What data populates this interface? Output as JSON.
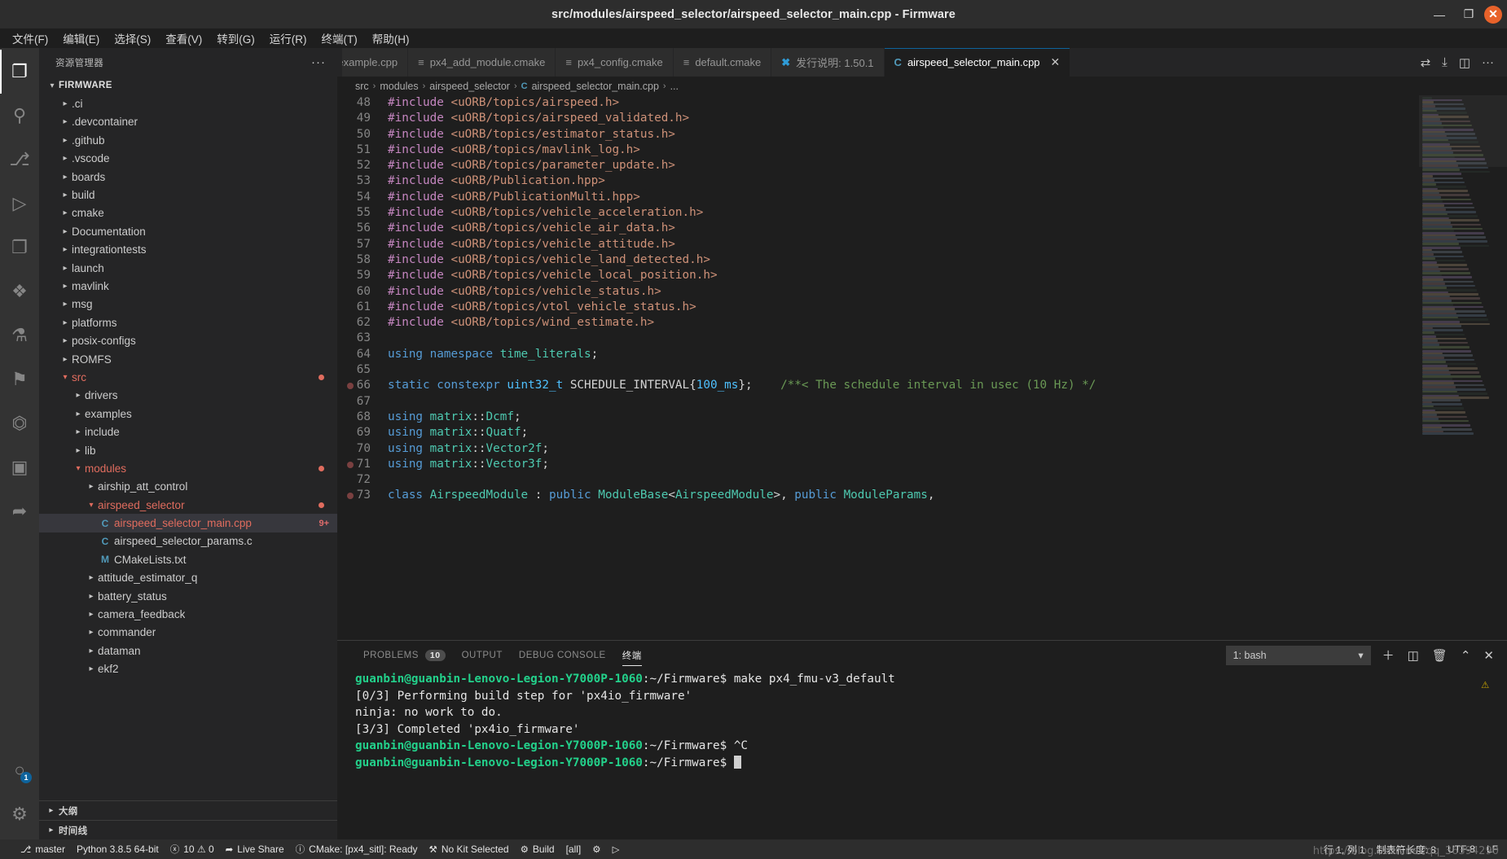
{
  "window": {
    "title": "src/modules/airspeed_selector/airspeed_selector_main.cpp - Firmware",
    "minimize": "—",
    "maximize": "❐",
    "close": "✕"
  },
  "menubar": [
    {
      "label": "文件(F)"
    },
    {
      "label": "编辑(E)"
    },
    {
      "label": "选择(S)"
    },
    {
      "label": "查看(V)"
    },
    {
      "label": "转到(G)"
    },
    {
      "label": "运行(R)"
    },
    {
      "label": "终端(T)"
    },
    {
      "label": "帮助(H)"
    }
  ],
  "activitybar": {
    "items": [
      {
        "name": "explorer",
        "glyph": "❐",
        "active": true
      },
      {
        "name": "search",
        "glyph": "⚲",
        "active": false
      },
      {
        "name": "source-control",
        "glyph": "⎇",
        "active": false
      },
      {
        "name": "run-debug",
        "glyph": "▷",
        "active": false
      },
      {
        "name": "remote-explorer",
        "glyph": "❐",
        "active": false
      },
      {
        "name": "extensions",
        "glyph": "❖",
        "active": false
      },
      {
        "name": "testing",
        "glyph": "⚗",
        "active": false
      },
      {
        "name": "gitlens",
        "glyph": "⚑",
        "active": false
      },
      {
        "name": "docker",
        "glyph": "⏣",
        "active": false
      },
      {
        "name": "cmake-tools",
        "glyph": "▣",
        "active": false
      },
      {
        "name": "live-share",
        "glyph": "➦",
        "active": false
      }
    ],
    "bottom": [
      {
        "name": "accounts",
        "glyph": "○",
        "badge": "1"
      },
      {
        "name": "settings-gear",
        "glyph": "⚙",
        "badge": ""
      }
    ]
  },
  "sidebar": {
    "title": "资源管理器",
    "more": "···",
    "root": "FIRMWARE",
    "tree": [
      {
        "label": ".ci",
        "indent": 1,
        "type": "folder",
        "open": false
      },
      {
        "label": ".devcontainer",
        "indent": 1,
        "type": "folder",
        "open": false
      },
      {
        "label": ".github",
        "indent": 1,
        "type": "folder",
        "open": false
      },
      {
        "label": ".vscode",
        "indent": 1,
        "type": "folder",
        "open": false
      },
      {
        "label": "boards",
        "indent": 1,
        "type": "folder",
        "open": false
      },
      {
        "label": "build",
        "indent": 1,
        "type": "folder",
        "open": false
      },
      {
        "label": "cmake",
        "indent": 1,
        "type": "folder",
        "open": false
      },
      {
        "label": "Documentation",
        "indent": 1,
        "type": "folder",
        "open": false
      },
      {
        "label": "integrationtests",
        "indent": 1,
        "type": "folder",
        "open": false
      },
      {
        "label": "launch",
        "indent": 1,
        "type": "folder",
        "open": false
      },
      {
        "label": "mavlink",
        "indent": 1,
        "type": "folder",
        "open": false
      },
      {
        "label": "msg",
        "indent": 1,
        "type": "folder",
        "open": false
      },
      {
        "label": "platforms",
        "indent": 1,
        "type": "folder",
        "open": false
      },
      {
        "label": "posix-configs",
        "indent": 1,
        "type": "folder",
        "open": false
      },
      {
        "label": "ROMFS",
        "indent": 1,
        "type": "folder",
        "open": false
      },
      {
        "label": "src",
        "indent": 1,
        "type": "folder",
        "open": true,
        "modified": true,
        "color": "#e06c5e"
      },
      {
        "label": "drivers",
        "indent": 2,
        "type": "folder",
        "open": false
      },
      {
        "label": "examples",
        "indent": 2,
        "type": "folder",
        "open": false
      },
      {
        "label": "include",
        "indent": 2,
        "type": "folder",
        "open": false
      },
      {
        "label": "lib",
        "indent": 2,
        "type": "folder",
        "open": false
      },
      {
        "label": "modules",
        "indent": 2,
        "type": "folder",
        "open": true,
        "modified": true,
        "color": "#e06c5e"
      },
      {
        "label": "airship_att_control",
        "indent": 3,
        "type": "folder",
        "open": false
      },
      {
        "label": "airspeed_selector",
        "indent": 3,
        "type": "folder",
        "open": true,
        "modified": true,
        "color": "#e06c5e"
      },
      {
        "label": "airspeed_selector_main.cpp",
        "indent": 4,
        "type": "cpp",
        "icon": "C",
        "selected": true,
        "badge": "9+",
        "color": "#e06c5e"
      },
      {
        "label": "airspeed_selector_params.c",
        "indent": 4,
        "type": "c",
        "icon": "C"
      },
      {
        "label": "CMakeLists.txt",
        "indent": 4,
        "type": "cmake",
        "icon": "M"
      },
      {
        "label": "attitude_estimator_q",
        "indent": 3,
        "type": "folder",
        "open": false
      },
      {
        "label": "battery_status",
        "indent": 3,
        "type": "folder",
        "open": false
      },
      {
        "label": "camera_feedback",
        "indent": 3,
        "type": "folder",
        "open": false
      },
      {
        "label": "commander",
        "indent": 3,
        "type": "folder",
        "open": false
      },
      {
        "label": "dataman",
        "indent": 3,
        "type": "folder",
        "open": false
      },
      {
        "label": "ekf2",
        "indent": 3,
        "type": "folder",
        "open": false
      }
    ],
    "sections": [
      {
        "label": "大纲"
      },
      {
        "label": "时间线"
      }
    ]
  },
  "tabs": [
    {
      "label": "example.cpp",
      "icon": "cpp",
      "active": false,
      "truncated": true
    },
    {
      "label": "px4_add_module.cmake",
      "icon": "cmake",
      "active": false
    },
    {
      "label": "px4_config.cmake",
      "icon": "cmake",
      "active": false
    },
    {
      "label": "default.cmake",
      "icon": "cmake",
      "active": false
    },
    {
      "label": "发行说明: 1.50.1",
      "icon": "vscode",
      "active": false
    },
    {
      "label": "airspeed_selector_main.cpp",
      "icon": "cpp",
      "active": true,
      "close": "✕"
    }
  ],
  "tabbar_actions": [
    {
      "name": "split-editor-compare-icon",
      "glyph": "⇄"
    },
    {
      "name": "run-build-icon",
      "glyph": "⤓"
    },
    {
      "name": "split-editor-icon",
      "glyph": "◫"
    },
    {
      "name": "more-actions-icon",
      "glyph": "···"
    }
  ],
  "breadcrumb": {
    "parts": [
      "src",
      "modules",
      "airspeed_selector"
    ],
    "file": "airspeed_selector_main.cpp",
    "tail": "...",
    "sep": "›"
  },
  "editor": {
    "first_line": 48,
    "lines": [
      {
        "n": 48,
        "tokens": [
          {
            "t": "#include ",
            "c": "s-pre"
          },
          {
            "t": "<uORB/topics/airspeed.h>",
            "c": "s-str"
          }
        ]
      },
      {
        "n": 49,
        "tokens": [
          {
            "t": "#include ",
            "c": "s-pre"
          },
          {
            "t": "<uORB/topics/airspeed_validated.h>",
            "c": "s-str"
          }
        ]
      },
      {
        "n": 50,
        "tokens": [
          {
            "t": "#include ",
            "c": "s-pre"
          },
          {
            "t": "<uORB/topics/estimator_status.h>",
            "c": "s-str"
          }
        ]
      },
      {
        "n": 51,
        "tokens": [
          {
            "t": "#include ",
            "c": "s-pre"
          },
          {
            "t": "<uORB/topics/mavlink_log.h>",
            "c": "s-str"
          }
        ]
      },
      {
        "n": 52,
        "tokens": [
          {
            "t": "#include ",
            "c": "s-pre"
          },
          {
            "t": "<uORB/topics/parameter_update.h>",
            "c": "s-str"
          }
        ]
      },
      {
        "n": 53,
        "tokens": [
          {
            "t": "#include ",
            "c": "s-pre"
          },
          {
            "t": "<uORB/Publication.hpp>",
            "c": "s-str"
          }
        ]
      },
      {
        "n": 54,
        "tokens": [
          {
            "t": "#include ",
            "c": "s-pre"
          },
          {
            "t": "<uORB/PublicationMulti.hpp>",
            "c": "s-str"
          }
        ]
      },
      {
        "n": 55,
        "tokens": [
          {
            "t": "#include ",
            "c": "s-pre"
          },
          {
            "t": "<uORB/topics/vehicle_acceleration.h>",
            "c": "s-str"
          }
        ]
      },
      {
        "n": 56,
        "tokens": [
          {
            "t": "#include ",
            "c": "s-pre"
          },
          {
            "t": "<uORB/topics/vehicle_air_data.h>",
            "c": "s-str"
          }
        ]
      },
      {
        "n": 57,
        "tokens": [
          {
            "t": "#include ",
            "c": "s-pre"
          },
          {
            "t": "<uORB/topics/vehicle_attitude.h>",
            "c": "s-str"
          }
        ]
      },
      {
        "n": 58,
        "tokens": [
          {
            "t": "#include ",
            "c": "s-pre"
          },
          {
            "t": "<uORB/topics/vehicle_land_detected.h>",
            "c": "s-str"
          }
        ]
      },
      {
        "n": 59,
        "tokens": [
          {
            "t": "#include ",
            "c": "s-pre"
          },
          {
            "t": "<uORB/topics/vehicle_local_position.h>",
            "c": "s-str"
          }
        ]
      },
      {
        "n": 60,
        "tokens": [
          {
            "t": "#include ",
            "c": "s-pre"
          },
          {
            "t": "<uORB/topics/vehicle_status.h>",
            "c": "s-str"
          }
        ]
      },
      {
        "n": 61,
        "tokens": [
          {
            "t": "#include ",
            "c": "s-pre"
          },
          {
            "t": "<uORB/topics/vtol_vehicle_status.h>",
            "c": "s-str"
          }
        ]
      },
      {
        "n": 62,
        "tokens": [
          {
            "t": "#include ",
            "c": "s-pre"
          },
          {
            "t": "<uORB/topics/wind_estimate.h>",
            "c": "s-str"
          }
        ]
      },
      {
        "n": 63,
        "tokens": []
      },
      {
        "n": 64,
        "tokens": [
          {
            "t": "using ",
            "c": "s-kw"
          },
          {
            "t": "namespace ",
            "c": "s-kw"
          },
          {
            "t": "time_literals",
            "c": "s-ns"
          },
          {
            "t": ";",
            "c": "s-plain"
          }
        ]
      },
      {
        "n": 65,
        "tokens": []
      },
      {
        "n": 66,
        "breakpoint": true,
        "tokens": [
          {
            "t": "static ",
            "c": "s-kw"
          },
          {
            "t": "constexpr ",
            "c": "s-kw"
          },
          {
            "t": "uint32_t ",
            "c": "s-const"
          },
          {
            "t": "SCHEDULE_INTERVAL",
            "c": "s-plain"
          },
          {
            "t": "{",
            "c": "s-plain"
          },
          {
            "t": "100_ms",
            "c": "s-const"
          },
          {
            "t": "};",
            "c": "s-plain"
          },
          {
            "t": "    ",
            "c": "s-plain"
          },
          {
            "t": "/**< The schedule interval in usec (10 Hz) */",
            "c": "s-com"
          }
        ]
      },
      {
        "n": 67,
        "tokens": []
      },
      {
        "n": 68,
        "tokens": [
          {
            "t": "using ",
            "c": "s-kw"
          },
          {
            "t": "matrix",
            "c": "s-ns"
          },
          {
            "t": "::",
            "c": "s-plain"
          },
          {
            "t": "Dcmf",
            "c": "s-ns"
          },
          {
            "t": ";",
            "c": "s-plain"
          }
        ]
      },
      {
        "n": 69,
        "tokens": [
          {
            "t": "using ",
            "c": "s-kw"
          },
          {
            "t": "matrix",
            "c": "s-ns"
          },
          {
            "t": "::",
            "c": "s-plain"
          },
          {
            "t": "Quatf",
            "c": "s-ns"
          },
          {
            "t": ";",
            "c": "s-plain"
          }
        ]
      },
      {
        "n": 70,
        "tokens": [
          {
            "t": "using ",
            "c": "s-kw"
          },
          {
            "t": "matrix",
            "c": "s-ns"
          },
          {
            "t": "::",
            "c": "s-plain"
          },
          {
            "t": "Vector2f",
            "c": "s-ns"
          },
          {
            "t": ";",
            "c": "s-plain"
          }
        ]
      },
      {
        "n": 71,
        "breakpoint": true,
        "tokens": [
          {
            "t": "using ",
            "c": "s-kw"
          },
          {
            "t": "matrix",
            "c": "s-ns"
          },
          {
            "t": "::",
            "c": "s-plain"
          },
          {
            "t": "Vector3f",
            "c": "s-ns"
          },
          {
            "t": ";",
            "c": "s-plain"
          }
        ]
      },
      {
        "n": 72,
        "tokens": []
      },
      {
        "n": 73,
        "breakpoint": true,
        "tokens": [
          {
            "t": "class ",
            "c": "s-kw"
          },
          {
            "t": "AirspeedModule",
            "c": "s-type"
          },
          {
            "t": " : ",
            "c": "s-plain"
          },
          {
            "t": "public ",
            "c": "s-kw"
          },
          {
            "t": "ModuleBase",
            "c": "s-type"
          },
          {
            "t": "<",
            "c": "s-plain"
          },
          {
            "t": "AirspeedModule",
            "c": "s-type"
          },
          {
            "t": ">, ",
            "c": "s-plain"
          },
          {
            "t": "public ",
            "c": "s-kw"
          },
          {
            "t": "ModuleParams",
            "c": "s-type"
          },
          {
            "t": ",",
            "c": "s-plain"
          }
        ]
      }
    ]
  },
  "panel": {
    "tabs": [
      {
        "label": "PROBLEMS",
        "count": "10",
        "active": false
      },
      {
        "label": "OUTPUT",
        "count": "",
        "active": false
      },
      {
        "label": "DEBUG CONSOLE",
        "count": "",
        "active": false
      },
      {
        "label": "终端",
        "count": "",
        "active": true
      }
    ],
    "terminal_select": "1: bash",
    "actions": [
      {
        "name": "new-terminal-icon",
        "glyph": "＋"
      },
      {
        "name": "split-terminal-icon",
        "glyph": "◫"
      },
      {
        "name": "kill-terminal-icon",
        "glyph": "🗑"
      },
      {
        "name": "maximize-panel-icon",
        "glyph": "⌃"
      },
      {
        "name": "close-panel-icon",
        "glyph": "✕"
      }
    ],
    "warning_icon": "⚠",
    "terminal_lines": [
      {
        "prompt": "guanbin@guanbin-Lenovo-Legion-Y7000P-1060",
        "path": ":~/Firmware$ ",
        "cmd": "make px4_fmu-v3_default"
      },
      {
        "plain": "[0/3] Performing build step for 'px4io_firmware'"
      },
      {
        "plain": "ninja: no work to do."
      },
      {
        "plain": "[3/3] Completed 'px4io_firmware'"
      },
      {
        "prompt": "guanbin@guanbin-Lenovo-Legion-Y7000P-1060",
        "path": ":~/Firmware$ ",
        "cmd": "^C"
      },
      {
        "prompt": "guanbin@guanbin-Lenovo-Legion-Y7000P-1060",
        "path": ":~/Firmware$ ",
        "cmd": "",
        "cursor": true
      }
    ]
  },
  "statusbar": {
    "left": [
      {
        "name": "remote-indicator",
        "icon": "",
        "label": ""
      },
      {
        "name": "git-branch",
        "icon": "⎇",
        "label": "master"
      },
      {
        "name": "python-version",
        "icon": "",
        "label": "Python 3.8.5 64-bit"
      },
      {
        "name": "problems",
        "icon": "ⓧ",
        "label": "10 ⚠ 0"
      },
      {
        "name": "live-share",
        "icon": "➦",
        "label": "Live Share"
      },
      {
        "name": "cmake-status",
        "icon": "ⓘ",
        "label": "CMake: [px4_sitl]: Ready"
      },
      {
        "name": "kit-selector",
        "icon": "⚒",
        "label": "No Kit Selected"
      },
      {
        "name": "build-button",
        "icon": "⚙",
        "label": "Build"
      },
      {
        "name": "build-target",
        "icon": "",
        "label": "[all]"
      },
      {
        "name": "debug-button",
        "icon": "⚙",
        "label": ""
      },
      {
        "name": "run-button",
        "icon": "▷",
        "label": ""
      }
    ],
    "right": [
      {
        "name": "cursor-position",
        "label": "行 1, 列 1"
      },
      {
        "name": "indentation",
        "label": "制表符长度: 8"
      },
      {
        "name": "encoding",
        "label": "UTF-8"
      },
      {
        "name": "eol",
        "label": "LF"
      }
    ]
  },
  "watermark": "https://blog.csdn.net/qq_36394290"
}
